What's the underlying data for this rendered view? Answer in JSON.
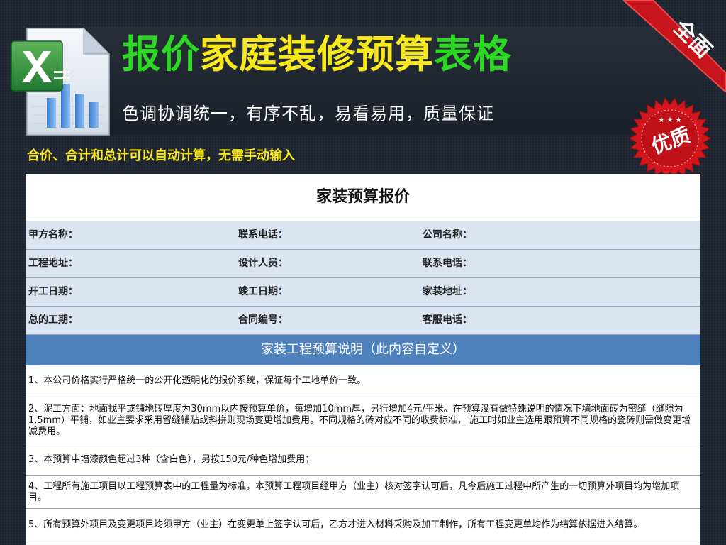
{
  "banner": {
    "title_part1": "报价",
    "title_part2": "家庭装修预算",
    "title_part3": "表格",
    "subtitle": "色调协调统一，有序不乱，易看易用，质量保证",
    "ribbon_text": "全面",
    "seal_text": "优质"
  },
  "notice": "合价、合计和总计可以自动计算，无需手动输入",
  "sheet": {
    "title": "家装预算报价",
    "info_rows": [
      [
        "甲方名称：",
        "联系电话：",
        "公司名称："
      ],
      [
        "工程地址：",
        "设计人员：",
        "联系电话："
      ],
      [
        "开工日期：",
        "竣工日期：",
        "家装地址："
      ],
      [
        "总的工期：",
        "合同编号：",
        "客服电话："
      ]
    ],
    "section_title": "家装工程预算说明（此内容自定义）",
    "notes": [
      "1、本公司价格实行严格统一的公开化透明化的报价系统，保证每个工地单价一致。",
      "2、泥工方面：地面找平或铺地砖厚度为30mm以内按预算单价，每增加10mm厚，另行增加4元/平米。在预算没有做特殊说明的情况下墙地面砖为密缝（缝隙为1.5mm）平铺，如业主要求采用留缝铺贴或斜拼则现场变更增加费用。不同规格的砖对应不同的收费标准， 施工时如业主选用跟预算不同规格的瓷砖则需做变更增减费用。",
      "3、本预算中墙漆颜色超过3种（含白色），另按150元/种色增加费用；",
      "4、工程所有施工项目以工程预算表中的工程量为标准，本预算工程项目经甲方（业主）核对签字认可后，凡今后施工过程中所产生的一切预算外项目均为增加项目。",
      "5、所有预算外项目及变更项目均须甲方（业主）在变更单上签字认可后，乙方才进入材料采购及加工制作，所有工程变更单均作为结算依据进入结算。"
    ]
  },
  "colors": {
    "background": "#1e2530",
    "title_green": "#2bd923",
    "title_yellow": "#f6e81c",
    "info_row_bg": "#dbe5f1",
    "section_header_bg": "#4f81bd",
    "ribbon_red": "#c8151c"
  },
  "icons": {
    "logo": "excel-chart-icon",
    "ribbon": "corner-ribbon",
    "seal": "starburst-badge"
  }
}
